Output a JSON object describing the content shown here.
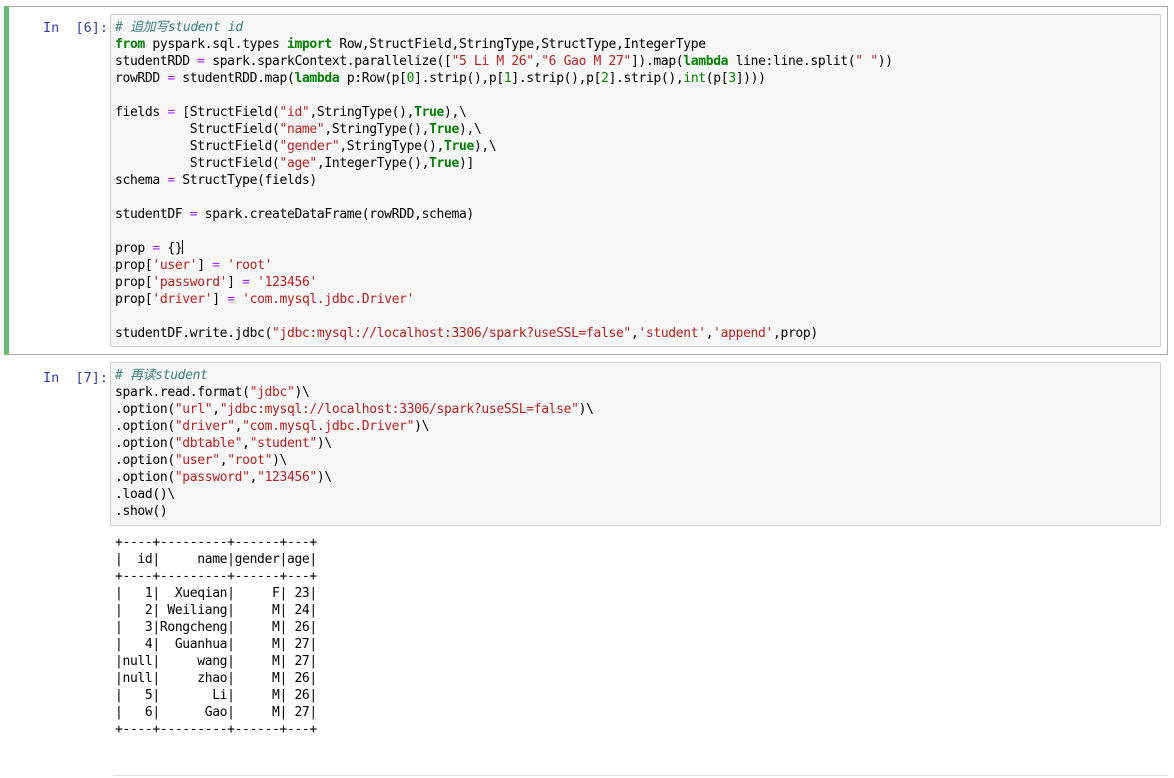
{
  "cells": [
    {
      "prompt": "In  [6]:",
      "lines": [
        [
          [
            "cm-comment",
            "# 追加写student id"
          ]
        ],
        [
          [
            "cm-keyword",
            "from"
          ],
          [
            "cm-plain",
            " pyspark.sql.types "
          ],
          [
            "cm-keyword",
            "import"
          ],
          [
            "cm-plain",
            " Row,StructField,StringType,StructType,IntegerType"
          ]
        ],
        [
          [
            "cm-plain",
            "studentRDD "
          ],
          [
            "cm-op",
            "="
          ],
          [
            "cm-plain",
            " spark.sparkContext.parallelize(["
          ],
          [
            "cm-string",
            "\"5 Li M 26\""
          ],
          [
            "cm-plain",
            ","
          ],
          [
            "cm-string",
            "\"6 Gao M 27\""
          ],
          [
            "cm-plain",
            "]).map("
          ],
          [
            "cm-keyword",
            "lambda"
          ],
          [
            "cm-plain",
            " line:line.split("
          ],
          [
            "cm-string",
            "\" \""
          ],
          [
            "cm-plain",
            "))"
          ]
        ],
        [
          [
            "cm-plain",
            "rowRDD "
          ],
          [
            "cm-op",
            "="
          ],
          [
            "cm-plain",
            " studentRDD.map("
          ],
          [
            "cm-keyword",
            "lambda"
          ],
          [
            "cm-plain",
            " p:Row(p["
          ],
          [
            "cm-number",
            "0"
          ],
          [
            "cm-plain",
            "].strip(),p["
          ],
          [
            "cm-number",
            "1"
          ],
          [
            "cm-plain",
            "].strip(),p["
          ],
          [
            "cm-number",
            "2"
          ],
          [
            "cm-plain",
            "].strip(),"
          ],
          [
            "cm-builtin",
            "int"
          ],
          [
            "cm-plain",
            "(p["
          ],
          [
            "cm-number",
            "3"
          ],
          [
            "cm-plain",
            "])))"
          ]
        ],
        [
          [
            "cm-plain",
            ""
          ]
        ],
        [
          [
            "cm-plain",
            "fields "
          ],
          [
            "cm-op",
            "="
          ],
          [
            "cm-plain",
            " [StructField("
          ],
          [
            "cm-string",
            "\"id\""
          ],
          [
            "cm-plain",
            ",StringType(),"
          ],
          [
            "cm-keyword",
            "True"
          ],
          [
            "cm-plain",
            "),\\"
          ]
        ],
        [
          [
            "cm-plain",
            "          StructField("
          ],
          [
            "cm-string",
            "\"name\""
          ],
          [
            "cm-plain",
            ",StringType(),"
          ],
          [
            "cm-keyword",
            "True"
          ],
          [
            "cm-plain",
            "),\\"
          ]
        ],
        [
          [
            "cm-plain",
            "          StructField("
          ],
          [
            "cm-string",
            "\"gender\""
          ],
          [
            "cm-plain",
            ",StringType(),"
          ],
          [
            "cm-keyword",
            "True"
          ],
          [
            "cm-plain",
            "),\\"
          ]
        ],
        [
          [
            "cm-plain",
            "          StructField("
          ],
          [
            "cm-string",
            "\"age\""
          ],
          [
            "cm-plain",
            ",IntegerType(),"
          ],
          [
            "cm-keyword",
            "True"
          ],
          [
            "cm-plain",
            ")]"
          ]
        ],
        [
          [
            "cm-plain",
            "schema "
          ],
          [
            "cm-op",
            "="
          ],
          [
            "cm-plain",
            " StructType(fields)"
          ]
        ],
        [
          [
            "cm-plain",
            ""
          ]
        ],
        [
          [
            "cm-plain",
            "studentDF "
          ],
          [
            "cm-op",
            "="
          ],
          [
            "cm-plain",
            " spark.createDataFrame(rowRDD,schema)"
          ]
        ],
        [
          [
            "cm-plain",
            ""
          ]
        ],
        [
          [
            "cm-plain",
            "prop "
          ],
          [
            "cm-op",
            "="
          ],
          [
            "cm-plain",
            " {}"
          ]
        ],
        [
          [
            "cm-plain",
            "prop["
          ],
          [
            "cm-string",
            "'user'"
          ],
          [
            "cm-plain",
            "] "
          ],
          [
            "cm-op",
            "="
          ],
          [
            "cm-plain",
            " "
          ],
          [
            "cm-string",
            "'root'"
          ]
        ],
        [
          [
            "cm-plain",
            "prop["
          ],
          [
            "cm-string",
            "'password'"
          ],
          [
            "cm-plain",
            "] "
          ],
          [
            "cm-op",
            "="
          ],
          [
            "cm-plain",
            " "
          ],
          [
            "cm-string",
            "'123456'"
          ]
        ],
        [
          [
            "cm-plain",
            "prop["
          ],
          [
            "cm-string",
            "'driver'"
          ],
          [
            "cm-plain",
            "] "
          ],
          [
            "cm-op",
            "="
          ],
          [
            "cm-plain",
            " "
          ],
          [
            "cm-string",
            "'com.mysql.jdbc.Driver'"
          ]
        ],
        [
          [
            "cm-plain",
            ""
          ]
        ],
        [
          [
            "cm-plain",
            "studentDF.write.jdbc("
          ],
          [
            "cm-string",
            "\"jdbc:mysql://localhost:3306/spark?useSSL=false\""
          ],
          [
            "cm-plain",
            ","
          ],
          [
            "cm-string",
            "'student'"
          ],
          [
            "cm-plain",
            ","
          ],
          [
            "cm-string",
            "'append'"
          ],
          [
            "cm-plain",
            ",prop)"
          ]
        ]
      ]
    },
    {
      "prompt": "In  [7]:",
      "lines": [
        [
          [
            "cm-comment",
            "# 再读student"
          ]
        ],
        [
          [
            "cm-plain",
            "spark.read.format("
          ],
          [
            "cm-string",
            "\"jdbc\""
          ],
          [
            "cm-plain",
            ")\\"
          ]
        ],
        [
          [
            "cm-plain",
            ".option("
          ],
          [
            "cm-string",
            "\"url\""
          ],
          [
            "cm-plain",
            ","
          ],
          [
            "cm-string",
            "\"jdbc:mysql://localhost:3306/spark?useSSL=false\""
          ],
          [
            "cm-plain",
            ")\\"
          ]
        ],
        [
          [
            "cm-plain",
            ".option("
          ],
          [
            "cm-string",
            "\"driver\""
          ],
          [
            "cm-plain",
            ","
          ],
          [
            "cm-string",
            "\"com.mysql.jdbc.Driver\""
          ],
          [
            "cm-plain",
            ")\\"
          ]
        ],
        [
          [
            "cm-plain",
            ".option("
          ],
          [
            "cm-string",
            "\"dbtable\""
          ],
          [
            "cm-plain",
            ","
          ],
          [
            "cm-string",
            "\"student\""
          ],
          [
            "cm-plain",
            ")\\"
          ]
        ],
        [
          [
            "cm-plain",
            ".option("
          ],
          [
            "cm-string",
            "\"user\""
          ],
          [
            "cm-plain",
            ","
          ],
          [
            "cm-string",
            "\"root\""
          ],
          [
            "cm-plain",
            ")\\"
          ]
        ],
        [
          [
            "cm-plain",
            ".option("
          ],
          [
            "cm-string",
            "\"password\""
          ],
          [
            "cm-plain",
            ","
          ],
          [
            "cm-string",
            "\"123456\""
          ],
          [
            "cm-plain",
            ")\\"
          ]
        ],
        [
          [
            "cm-plain",
            ".load()\\"
          ]
        ],
        [
          [
            "cm-plain",
            ".show()"
          ]
        ]
      ]
    }
  ],
  "output": {
    "lines": [
      "+----+---------+------+---+",
      "|  id|     name|gender|age|",
      "+----+---------+------+---+",
      "|   1|  Xueqian|     F| 23|",
      "|   2| Weiliang|     M| 24|",
      "|   3|Rongcheng|     M| 26|",
      "|   4|  Guanhua|     M| 27|",
      "|null|     wang|     M| 27|",
      "|null|     zhao|     M| 26|",
      "|   5|       Li|     M| 26|",
      "|   6|      Gao|     M| 27|",
      "+----+---------+------+---+"
    ]
  },
  "colors": {
    "prompt": "#303f9f",
    "selected_border": "#66bb6a",
    "keyword": "#008000",
    "string": "#ba2121",
    "comment": "#408080"
  }
}
